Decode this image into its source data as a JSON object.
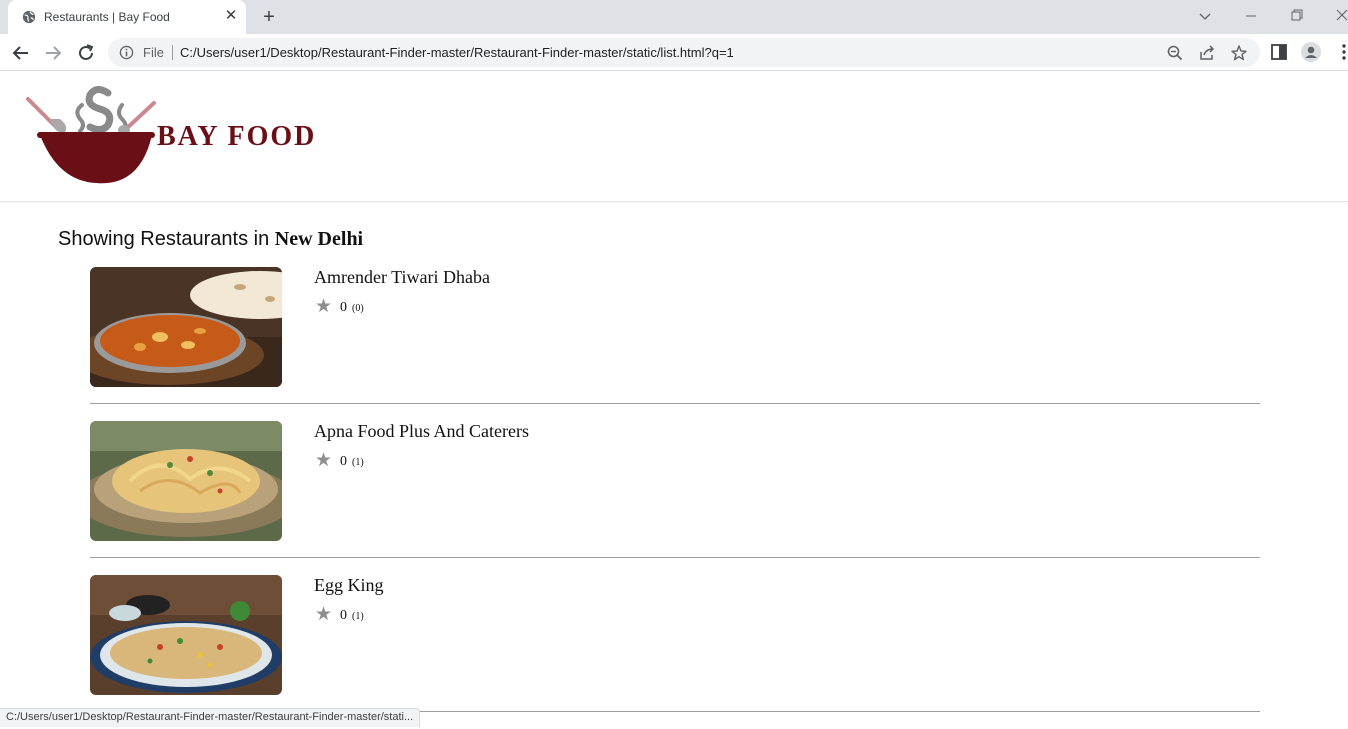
{
  "browser": {
    "tab_title": "Restaurants | Bay Food",
    "new_tab_glyph": "+",
    "close_glyph": "✕",
    "omnibox": {
      "scheme_label": "File",
      "url": "C:/Users/user1/Desktop/Restaurant-Finder-master/Restaurant-Finder-master/static/list.html?q=1"
    },
    "status_url": "C:/Users/user1/Desktop/Restaurant-Finder-master/Restaurant-Finder-master/stati..."
  },
  "site": {
    "brand_name": "BAY FOOD",
    "brand_color": "#6b0f16"
  },
  "listing": {
    "prefix": "Showing Restaurants in ",
    "city": "New Delhi",
    "restaurants": [
      {
        "name": "Amrender Tiwari Dhaba",
        "rating": "0",
        "reviews": "(0)",
        "image": "paneer-curry-with-naan"
      },
      {
        "name": "Apna Food Plus And Caterers",
        "rating": "0",
        "reviews": "(1)",
        "image": "noodles-on-leaf-plate"
      },
      {
        "name": "Egg King",
        "rating": "0",
        "reviews": "(1)",
        "image": "fried-rice-bowl"
      }
    ]
  },
  "icons": {
    "star": "★",
    "star_color": "#8f8f8f"
  }
}
